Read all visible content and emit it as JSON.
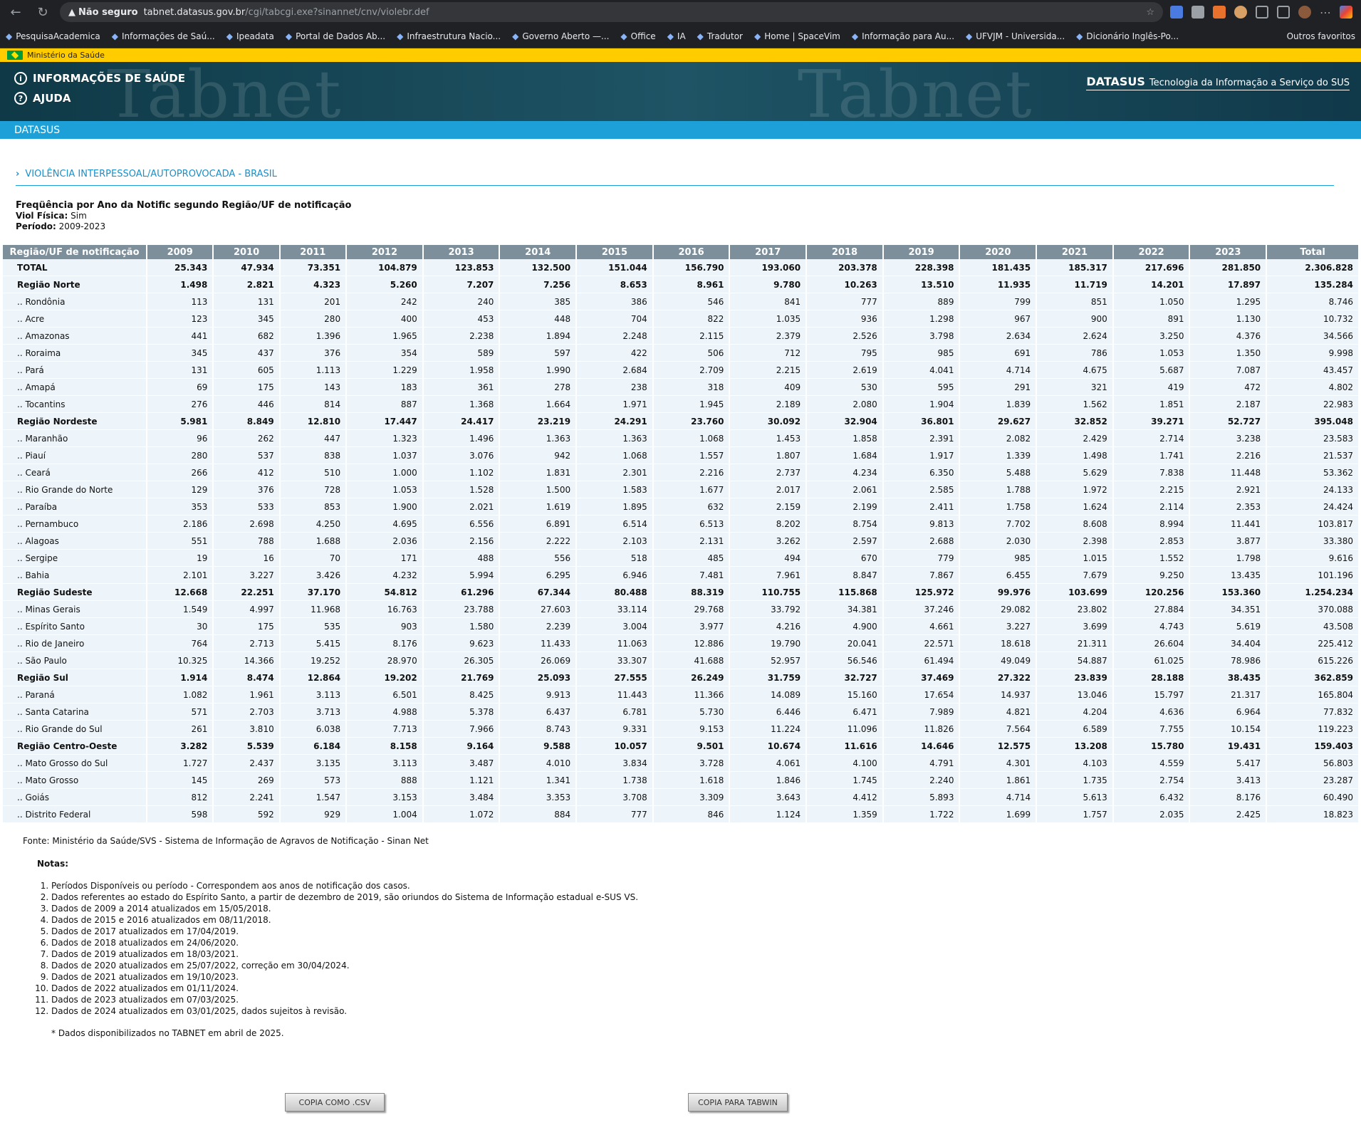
{
  "browser": {
    "security": "Não seguro",
    "url_host": "tabnet.datasus.gov.br",
    "url_path": "/cgi/tabcgi.exe?sinannet/cnv/violebr.def",
    "bookmarks": [
      "PesquisaAcademica",
      "Informações de Saú...",
      "Ipeadata",
      "Portal de Dados Ab...",
      "Infraestrutura Nacio...",
      "Governo Aberto —...",
      "Office",
      "IA",
      "Tradutor",
      "Home | SpaceVim",
      "Informação para Au...",
      "UFVJM - Universida...",
      "Dicionário Inglês-Po..."
    ],
    "other_bookmarks": "Outros favoritos"
  },
  "gov_bar": "Ministério da Saúde",
  "header": {
    "menu1": "INFORMAÇÕES DE SAÚDE",
    "menu2": "AJUDA",
    "brand_bold": "DATASUS",
    "brand_text": "Tecnologia da Informação a Serviço do SUS",
    "bar": "DATASUS",
    "watermark": "Tabnet"
  },
  "section_title": "VIOLÊNCIA INTERPESSOAL/AUTOPROVOCADA - BRASIL",
  "query": {
    "title": "Freqüência por Ano da Notific segundo Região/UF de notificação",
    "filter_label": "Viol Física:",
    "filter_value": "Sim",
    "period_label": "Período:",
    "period_value": "2009-2023"
  },
  "table": {
    "headers": [
      "Região/UF de notificação",
      "2009",
      "2010",
      "2011",
      "2012",
      "2013",
      "2014",
      "2015",
      "2016",
      "2017",
      "2018",
      "2019",
      "2020",
      "2021",
      "2022",
      "2023",
      "Total"
    ],
    "rows": [
      {
        "b": true,
        "label": "TOTAL",
        "v": [
          "25.343",
          "47.934",
          "73.351",
          "104.879",
          "123.853",
          "132.500",
          "151.044",
          "156.790",
          "193.060",
          "203.378",
          "228.398",
          "181.435",
          "185.317",
          "217.696",
          "281.850",
          "2.306.828"
        ]
      },
      {
        "b": true,
        "label": "Região Norte",
        "v": [
          "1.498",
          "2.821",
          "4.323",
          "5.260",
          "7.207",
          "7.256",
          "8.653",
          "8.961",
          "9.780",
          "10.263",
          "13.510",
          "11.935",
          "11.719",
          "14.201",
          "17.897",
          "135.284"
        ]
      },
      {
        "label": ".. Rondônia",
        "v": [
          "113",
          "131",
          "201",
          "242",
          "240",
          "385",
          "386",
          "546",
          "841",
          "777",
          "889",
          "799",
          "851",
          "1.050",
          "1.295",
          "8.746"
        ]
      },
      {
        "label": ".. Acre",
        "v": [
          "123",
          "345",
          "280",
          "400",
          "453",
          "448",
          "704",
          "822",
          "1.035",
          "936",
          "1.298",
          "967",
          "900",
          "891",
          "1.130",
          "10.732"
        ]
      },
      {
        "label": ".. Amazonas",
        "v": [
          "441",
          "682",
          "1.396",
          "1.965",
          "2.238",
          "1.894",
          "2.248",
          "2.115",
          "2.379",
          "2.526",
          "3.798",
          "2.634",
          "2.624",
          "3.250",
          "4.376",
          "34.566"
        ]
      },
      {
        "label": ".. Roraima",
        "v": [
          "345",
          "437",
          "376",
          "354",
          "589",
          "597",
          "422",
          "506",
          "712",
          "795",
          "985",
          "691",
          "786",
          "1.053",
          "1.350",
          "9.998"
        ]
      },
      {
        "label": ".. Pará",
        "v": [
          "131",
          "605",
          "1.113",
          "1.229",
          "1.958",
          "1.990",
          "2.684",
          "2.709",
          "2.215",
          "2.619",
          "4.041",
          "4.714",
          "4.675",
          "5.687",
          "7.087",
          "43.457"
        ]
      },
      {
        "label": ".. Amapá",
        "v": [
          "69",
          "175",
          "143",
          "183",
          "361",
          "278",
          "238",
          "318",
          "409",
          "530",
          "595",
          "291",
          "321",
          "419",
          "472",
          "4.802"
        ]
      },
      {
        "label": ".. Tocantins",
        "v": [
          "276",
          "446",
          "814",
          "887",
          "1.368",
          "1.664",
          "1.971",
          "1.945",
          "2.189",
          "2.080",
          "1.904",
          "1.839",
          "1.562",
          "1.851",
          "2.187",
          "22.983"
        ]
      },
      {
        "b": true,
        "label": "Região Nordeste",
        "v": [
          "5.981",
          "8.849",
          "12.810",
          "17.447",
          "24.417",
          "23.219",
          "24.291",
          "23.760",
          "30.092",
          "32.904",
          "36.801",
          "29.627",
          "32.852",
          "39.271",
          "52.727",
          "395.048"
        ]
      },
      {
        "label": ".. Maranhão",
        "v": [
          "96",
          "262",
          "447",
          "1.323",
          "1.496",
          "1.363",
          "1.363",
          "1.068",
          "1.453",
          "1.858",
          "2.391",
          "2.082",
          "2.429",
          "2.714",
          "3.238",
          "23.583"
        ]
      },
      {
        "label": ".. Piauí",
        "v": [
          "280",
          "537",
          "838",
          "1.037",
          "3.076",
          "942",
          "1.068",
          "1.557",
          "1.807",
          "1.684",
          "1.917",
          "1.339",
          "1.498",
          "1.741",
          "2.216",
          "21.537"
        ]
      },
      {
        "label": ".. Ceará",
        "v": [
          "266",
          "412",
          "510",
          "1.000",
          "1.102",
          "1.831",
          "2.301",
          "2.216",
          "2.737",
          "4.234",
          "6.350",
          "5.488",
          "5.629",
          "7.838",
          "11.448",
          "53.362"
        ]
      },
      {
        "label": ".. Rio Grande do Norte",
        "v": [
          "129",
          "376",
          "728",
          "1.053",
          "1.528",
          "1.500",
          "1.583",
          "1.677",
          "2.017",
          "2.061",
          "2.585",
          "1.788",
          "1.972",
          "2.215",
          "2.921",
          "24.133"
        ]
      },
      {
        "label": ".. Paraíba",
        "v": [
          "353",
          "533",
          "853",
          "1.900",
          "2.021",
          "1.619",
          "1.895",
          "632",
          "2.159",
          "2.199",
          "2.411",
          "1.758",
          "1.624",
          "2.114",
          "2.353",
          "24.424"
        ]
      },
      {
        "label": ".. Pernambuco",
        "v": [
          "2.186",
          "2.698",
          "4.250",
          "4.695",
          "6.556",
          "6.891",
          "6.514",
          "6.513",
          "8.202",
          "8.754",
          "9.813",
          "7.702",
          "8.608",
          "8.994",
          "11.441",
          "103.817"
        ]
      },
      {
        "label": ".. Alagoas",
        "v": [
          "551",
          "788",
          "1.688",
          "2.036",
          "2.156",
          "2.222",
          "2.103",
          "2.131",
          "3.262",
          "2.597",
          "2.688",
          "2.030",
          "2.398",
          "2.853",
          "3.877",
          "33.380"
        ]
      },
      {
        "label": ".. Sergipe",
        "v": [
          "19",
          "16",
          "70",
          "171",
          "488",
          "556",
          "518",
          "485",
          "494",
          "670",
          "779",
          "985",
          "1.015",
          "1.552",
          "1.798",
          "9.616"
        ]
      },
      {
        "label": ".. Bahia",
        "v": [
          "2.101",
          "3.227",
          "3.426",
          "4.232",
          "5.994",
          "6.295",
          "6.946",
          "7.481",
          "7.961",
          "8.847",
          "7.867",
          "6.455",
          "7.679",
          "9.250",
          "13.435",
          "101.196"
        ]
      },
      {
        "b": true,
        "label": "Região Sudeste",
        "v": [
          "12.668",
          "22.251",
          "37.170",
          "54.812",
          "61.296",
          "67.344",
          "80.488",
          "88.319",
          "110.755",
          "115.868",
          "125.972",
          "99.976",
          "103.699",
          "120.256",
          "153.360",
          "1.254.234"
        ]
      },
      {
        "label": ".. Minas Gerais",
        "v": [
          "1.549",
          "4.997",
          "11.968",
          "16.763",
          "23.788",
          "27.603",
          "33.114",
          "29.768",
          "33.792",
          "34.381",
          "37.246",
          "29.082",
          "23.802",
          "27.884",
          "34.351",
          "370.088"
        ]
      },
      {
        "label": ".. Espírito Santo",
        "v": [
          "30",
          "175",
          "535",
          "903",
          "1.580",
          "2.239",
          "3.004",
          "3.977",
          "4.216",
          "4.900",
          "4.661",
          "3.227",
          "3.699",
          "4.743",
          "5.619",
          "43.508"
        ]
      },
      {
        "label": ".. Rio de Janeiro",
        "v": [
          "764",
          "2.713",
          "5.415",
          "8.176",
          "9.623",
          "11.433",
          "11.063",
          "12.886",
          "19.790",
          "20.041",
          "22.571",
          "18.618",
          "21.311",
          "26.604",
          "34.404",
          "225.412"
        ]
      },
      {
        "label": ".. São Paulo",
        "v": [
          "10.325",
          "14.366",
          "19.252",
          "28.970",
          "26.305",
          "26.069",
          "33.307",
          "41.688",
          "52.957",
          "56.546",
          "61.494",
          "49.049",
          "54.887",
          "61.025",
          "78.986",
          "615.226"
        ]
      },
      {
        "b": true,
        "label": "Região Sul",
        "v": [
          "1.914",
          "8.474",
          "12.864",
          "19.202",
          "21.769",
          "25.093",
          "27.555",
          "26.249",
          "31.759",
          "32.727",
          "37.469",
          "27.322",
          "23.839",
          "28.188",
          "38.435",
          "362.859"
        ]
      },
      {
        "label": ".. Paraná",
        "v": [
          "1.082",
          "1.961",
          "3.113",
          "6.501",
          "8.425",
          "9.913",
          "11.443",
          "11.366",
          "14.089",
          "15.160",
          "17.654",
          "14.937",
          "13.046",
          "15.797",
          "21.317",
          "165.804"
        ]
      },
      {
        "label": ".. Santa Catarina",
        "v": [
          "571",
          "2.703",
          "3.713",
          "4.988",
          "5.378",
          "6.437",
          "6.781",
          "5.730",
          "6.446",
          "6.471",
          "7.989",
          "4.821",
          "4.204",
          "4.636",
          "6.964",
          "77.832"
        ]
      },
      {
        "label": ".. Rio Grande do Sul",
        "v": [
          "261",
          "3.810",
          "6.038",
          "7.713",
          "7.966",
          "8.743",
          "9.331",
          "9.153",
          "11.224",
          "11.096",
          "11.826",
          "7.564",
          "6.589",
          "7.755",
          "10.154",
          "119.223"
        ]
      },
      {
        "b": true,
        "label": "Região Centro-Oeste",
        "v": [
          "3.282",
          "5.539",
          "6.184",
          "8.158",
          "9.164",
          "9.588",
          "10.057",
          "9.501",
          "10.674",
          "11.616",
          "14.646",
          "12.575",
          "13.208",
          "15.780",
          "19.431",
          "159.403"
        ]
      },
      {
        "label": ".. Mato Grosso do Sul",
        "v": [
          "1.727",
          "2.437",
          "3.135",
          "3.113",
          "3.487",
          "4.010",
          "3.834",
          "3.728",
          "4.061",
          "4.100",
          "4.791",
          "4.301",
          "4.103",
          "4.559",
          "5.417",
          "56.803"
        ]
      },
      {
        "label": ".. Mato Grosso",
        "v": [
          "145",
          "269",
          "573",
          "888",
          "1.121",
          "1.341",
          "1.738",
          "1.618",
          "1.846",
          "1.745",
          "2.240",
          "1.861",
          "1.735",
          "2.754",
          "3.413",
          "23.287"
        ]
      },
      {
        "label": ".. Goiás",
        "v": [
          "812",
          "2.241",
          "1.547",
          "3.153",
          "3.484",
          "3.353",
          "3.708",
          "3.309",
          "3.643",
          "4.412",
          "5.893",
          "4.714",
          "5.613",
          "6.432",
          "8.176",
          "60.490"
        ]
      },
      {
        "label": ".. Distrito Federal",
        "v": [
          "598",
          "592",
          "929",
          "1.004",
          "1.072",
          "884",
          "777",
          "846",
          "1.124",
          "1.359",
          "1.722",
          "1.699",
          "1.757",
          "2.035",
          "2.425",
          "18.823"
        ]
      }
    ]
  },
  "fonte": "Fonte: Ministério da Saúde/SVS - Sistema de Informação de Agravos de Notificação - Sinan Net",
  "notas_title": "Notas:",
  "notas": [
    "Períodos Disponíveis ou período - Correspondem aos anos de notificação dos casos.",
    "Dados referentes ao estado do Espírito Santo, a partir de dezembro de 2019, são oriundos do Sistema de Informação estadual e-SUS VS.",
    "Dados de 2009 a 2014 atualizados em 15/05/2018.",
    "Dados de 2015 e 2016 atualizados em 08/11/2018.",
    "Dados de 2017 atualizados em 17/04/2019.",
    "Dados de 2018 atualizados em 24/06/2020.",
    "Dados de 2019 atualizados em 18/03/2021.",
    "Dados de 2020 atualizados em 25/07/2022, correção em 30/04/2024.",
    "Dados de 2021 atualizados em 19/10/2023.",
    "Dados de 2022 atualizados em 01/11/2024.",
    "Dados de 2023 atualizados em 07/03/2025.",
    "Dados de 2024 atualizados em 03/01/2025, dados sujeitos à revisão."
  ],
  "footnote": "* Dados disponibilizados no TABNET em abril de 2025.",
  "buttons": {
    "csv": "COPIA COMO .CSV",
    "tabwin": "COPIA PARA TABWIN"
  }
}
